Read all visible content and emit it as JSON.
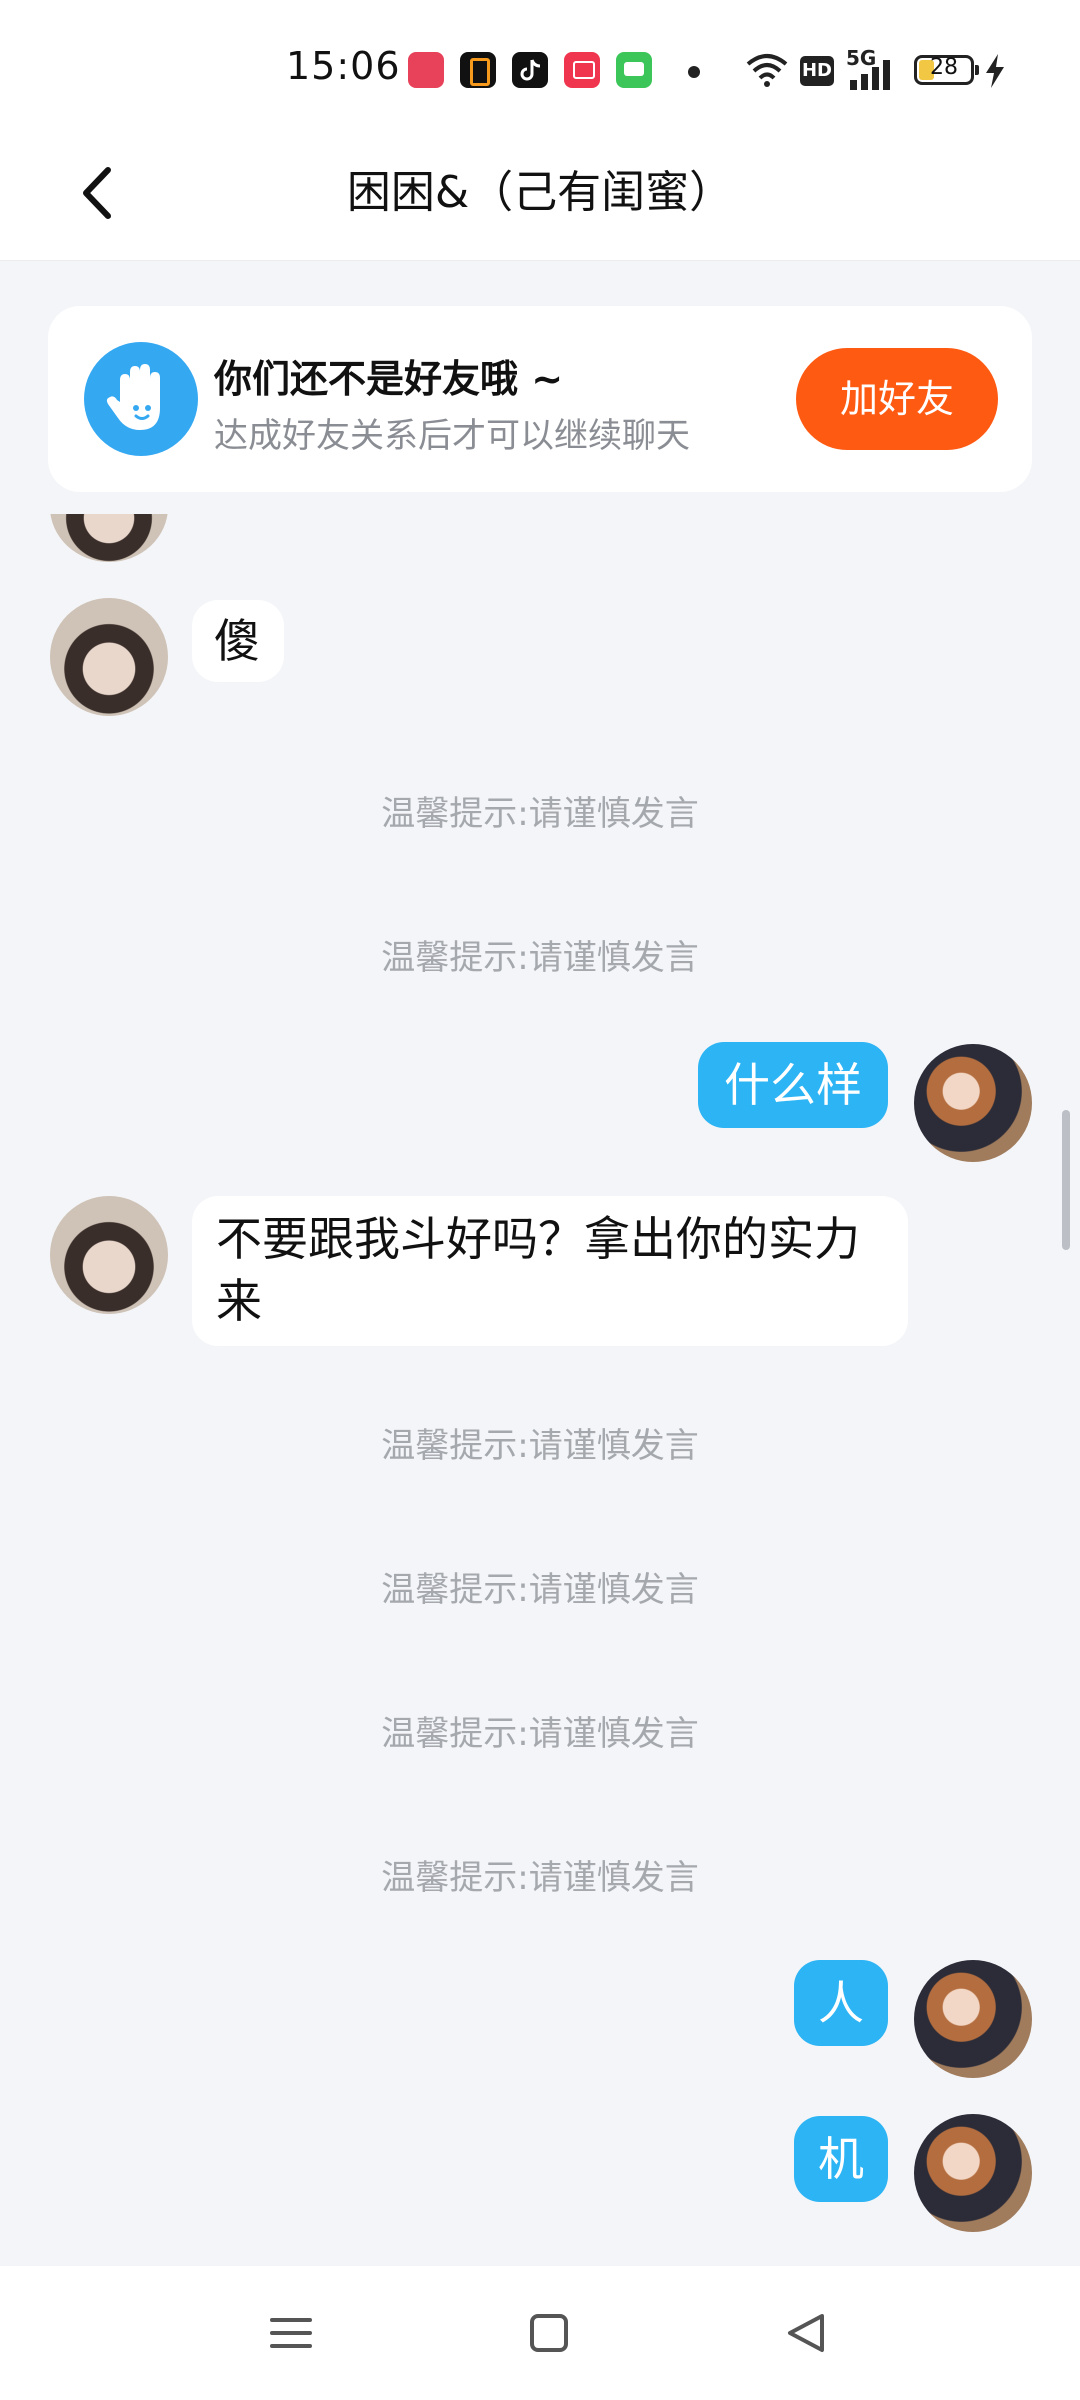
{
  "status_bar": {
    "time": "15:06",
    "battery_percent": "28",
    "network": "5G",
    "hd_label": "HD",
    "app_icons": [
      "screen-recorder-icon",
      "orange-app-icon",
      "tiktok-icon",
      "red-app-icon",
      "green-chat-icon"
    ]
  },
  "header": {
    "title": "困困&（己有闺蜜）"
  },
  "banner": {
    "title": "你们还不是好友哦 ~",
    "subtitle": "达成好友关系后才可以继续聊天",
    "add_button": "加好友"
  },
  "messages": [
    {
      "side": "in",
      "text": "傻"
    },
    {
      "side": "hint",
      "text": "温馨提示:请谨慎发言"
    },
    {
      "side": "hint",
      "text": "温馨提示:请谨慎发言"
    },
    {
      "side": "out",
      "text": "什么样"
    },
    {
      "side": "in",
      "text": "不要跟我斗好吗？拿出你的实力来"
    },
    {
      "side": "hint",
      "text": "温馨提示:请谨慎发言"
    },
    {
      "side": "hint",
      "text": "温馨提示:请谨慎发言"
    },
    {
      "side": "hint",
      "text": "温馨提示:请谨慎发言"
    },
    {
      "side": "hint",
      "text": "温馨提示:请谨慎发言"
    },
    {
      "side": "out",
      "text": "人"
    },
    {
      "side": "out",
      "text": "机"
    }
  ],
  "colors": {
    "accent_blue": "#2cb4f4",
    "add_button": "#ff5a12",
    "background": "#f3f5f8"
  }
}
